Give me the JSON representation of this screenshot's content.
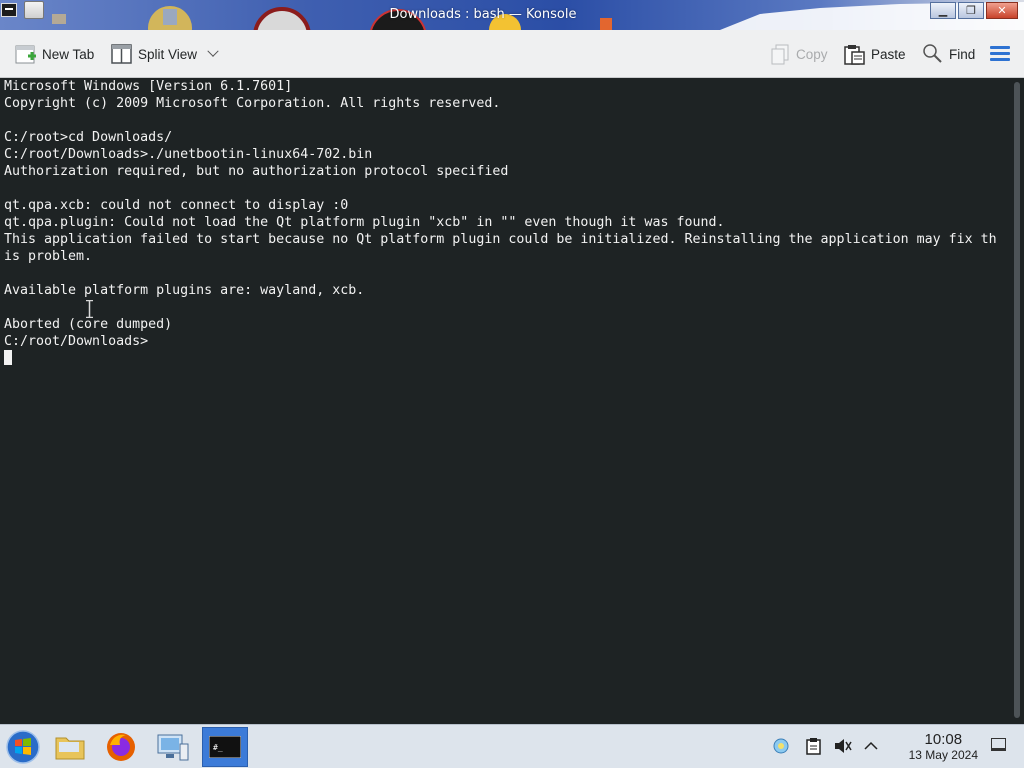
{
  "window": {
    "title": "Downloads : bash — Konsole"
  },
  "toolbar": {
    "new_tab": "New Tab",
    "split_view": "Split View",
    "copy": "Copy",
    "paste": "Paste",
    "find": "Find"
  },
  "terminal": {
    "lines": [
      "Microsoft Windows [Version 6.1.7601]",
      "Copyright (c) 2009 Microsoft Corporation. All rights reserved.",
      "",
      "C:/root>cd Downloads/",
      "C:/root/Downloads>./unetbootin-linux64-702.bin",
      "Authorization required, but no authorization protocol specified",
      "",
      "qt.qpa.xcb: could not connect to display :0",
      "qt.qpa.plugin: Could not load the Qt platform plugin \"xcb\" in \"\" even though it was found.",
      "This application failed to start because no Qt platform plugin could be initialized. Reinstalling the application may fix th",
      "is problem.",
      "",
      "Available platform plugins are: wayland, xcb.",
      "",
      "Aborted (core dumped)",
      "C:/root/Downloads>"
    ]
  },
  "taskbar": {
    "time": "10:08",
    "date": "13 May 2024",
    "apps": [
      "start-menu",
      "file-manager",
      "firefox",
      "system-settings",
      "konsole"
    ]
  },
  "colors": {
    "terminal_bg": "#1e2324",
    "terminal_fg": "#f2f2f2",
    "accent": "#2d72d2"
  }
}
